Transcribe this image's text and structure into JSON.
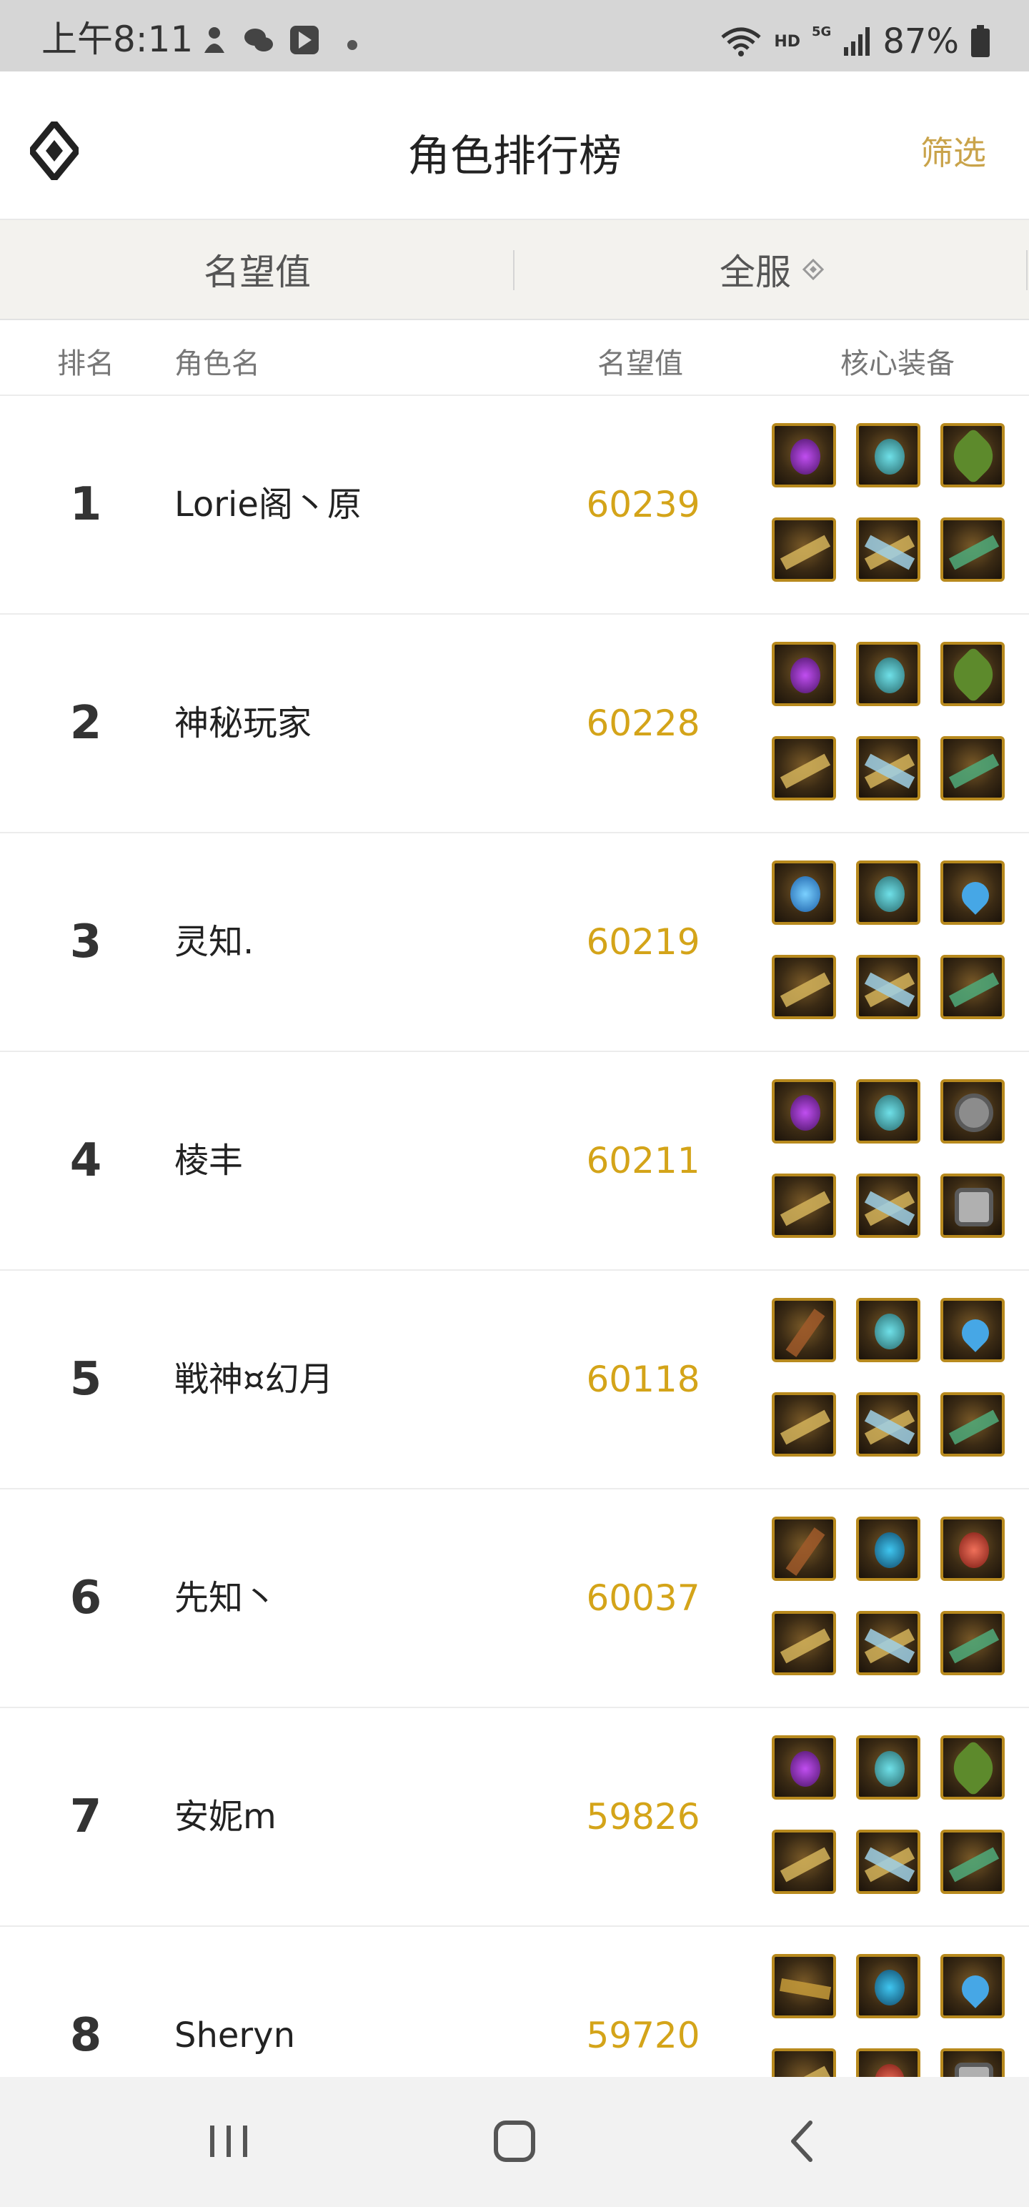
{
  "status_bar": {
    "time": "上午8:11",
    "network": "HD",
    "signal": "5G",
    "battery": "87%",
    "icons": [
      "notification-app-icon",
      "wechat-icon",
      "app-icon",
      "more-dot-icon",
      "wifi-icon",
      "signal-icon",
      "battery-icon"
    ]
  },
  "header": {
    "title": "角色排行榜",
    "filter_label": "筛选",
    "logo_icon": "diamond-logo-icon",
    "accent_color": "#c9a34a"
  },
  "tabs": [
    {
      "label": "名望值"
    },
    {
      "label": "全服"
    }
  ],
  "columns": {
    "rank": "排名",
    "name": "角色名",
    "score": "名望值",
    "equip": "核心装备"
  },
  "rows": [
    {
      "rank": "1",
      "name": "Lorie阁丶原",
      "score": "60239",
      "equips": [
        "purple",
        "blue",
        "leaf",
        "gold",
        "cross",
        "green"
      ]
    },
    {
      "rank": "2",
      "name": "神秘玩家",
      "score": "60228",
      "equips": [
        "purple",
        "blue",
        "leaf",
        "gold",
        "cross",
        "green"
      ]
    },
    {
      "rank": "3",
      "name": "灵知.",
      "score": "60219",
      "equips": [
        "potion",
        "blue",
        "drop",
        "gold",
        "cross",
        "green"
      ]
    },
    {
      "rank": "4",
      "name": "棱丰",
      "score": "60211",
      "equips": [
        "purple",
        "blue",
        "gear",
        "gold",
        "cross",
        "armor"
      ]
    },
    {
      "rank": "5",
      "name": "戦神¤幻月",
      "score": "60118",
      "equips": [
        "staff",
        "blue",
        "drop",
        "gold",
        "cross",
        "green"
      ]
    },
    {
      "rank": "6",
      "name": "先知丶",
      "score": "60037",
      "equips": [
        "staff",
        "cyan",
        "red",
        "gold",
        "cross",
        "green"
      ]
    },
    {
      "rank": "7",
      "name": "安妮m",
      "score": "59826",
      "equips": [
        "purple",
        "blue",
        "leaf",
        "gold",
        "cross",
        "green"
      ]
    },
    {
      "rank": "8",
      "name": "Sheryn",
      "score": "59720",
      "equips": [
        "rune",
        "cyan",
        "drop",
        "gold",
        "red",
        "armor"
      ]
    }
  ],
  "colors": {
    "score": "#d4a419",
    "tab_bg": "#f3f2ee"
  },
  "nav": [
    "recent-apps-icon",
    "home-icon",
    "back-icon"
  ]
}
